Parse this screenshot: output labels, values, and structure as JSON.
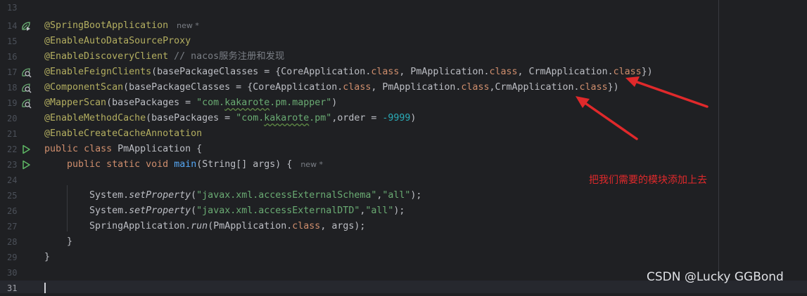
{
  "lines": {
    "l13": "13",
    "l14": "14",
    "l15": "15",
    "l16": "16",
    "l17": "17",
    "l18": "18",
    "l19": "19",
    "l20": "20",
    "l21": "21",
    "l22": "22",
    "l23": "23",
    "l24": "24",
    "l25": "25",
    "l26": "26",
    "l27": "27",
    "l28": "28",
    "l29": "29",
    "l30": "30",
    "l31": "31"
  },
  "code": {
    "l14_ann": "@SpringBootApplication",
    "l14_hint": "new *",
    "l15_ann": "@EnableAutoDataSourceProxy",
    "l16_ann": "@EnableDiscoveryClient",
    "l16_cmt": "// nacos服务注册和发现",
    "l17_ann": "@EnableFeignClients",
    "l17_a": "(basePackageClasses = {CoreApplication.",
    "l17_b": ", PmApplication.",
    "l17_c": ", CrmApplication.",
    "l17_end": "})",
    "l18_ann": "@ComponentScan",
    "l18_a": "(basePackageClasses = {CoreApplication.",
    "l18_b": ", PmApplication.",
    "l18_c": ",CrmApplication.",
    "l18_end": "})",
    "l19_ann": "@MapperScan",
    "l19_a": "(basePackages = ",
    "l19_s1": "\"com.",
    "l19_s2": "kakarote",
    "l19_s3": ".pm.mapper\"",
    "l19_end": ")",
    "l20_ann": "@EnableMethodCache",
    "l20_a": "(basePackages = ",
    "l20_s1": "\"com.",
    "l20_s2": "kakarote",
    "l20_s3": ".pm\"",
    "l20_b": ",order = ",
    "l20_num": "-9999",
    "l20_end": ")",
    "l21_ann": "@EnableCreateCacheAnnotation",
    "kw_class": "class",
    "kw_public": "public",
    "kw_static": "static",
    "kw_void": "void",
    "l22_name": " PmApplication {",
    "l23_fn": "main",
    "l23_rest": "(String[] args) {",
    "l23_hint": "new *",
    "l25_a": "System.",
    "l25_m": "setProperty",
    "l25_s1": "\"javax.xml.accessExternalSchema\"",
    "l25_s2": "\"all\"",
    "l26_a": "System.",
    "l26_m": "setProperty",
    "l26_s1": "\"javax.xml.accessExternalDTD\"",
    "l26_s2": "\"all\"",
    "l27_a": "SpringApplication.",
    "l27_m": "run",
    "l27_b": "(PmApplication.",
    "l27_end": ", args);",
    "l28": "}",
    "l29": "}"
  },
  "annotation_note": "把我们需要的模块添加上去",
  "watermark": "CSDN @Lucky GGBond",
  "icons": {
    "l14": "spring-bean-run-icon",
    "l17": "bean-search-icon",
    "l18": "bean-search-icon",
    "l19": "bean-search-icon",
    "l22": "run-triangle-icon",
    "l23": "run-triangle-icon"
  },
  "colors": {
    "annotation_arrow": "#e0292b",
    "background": "#1f2023"
  }
}
